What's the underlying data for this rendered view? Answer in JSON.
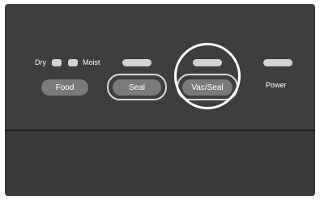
{
  "panel": {
    "dry_label": "Dry",
    "moist_label": "Moist",
    "food_button": "Food",
    "seal_button": "Seal",
    "vacseal_button": "Vac/Seal",
    "power_label": "Power"
  }
}
